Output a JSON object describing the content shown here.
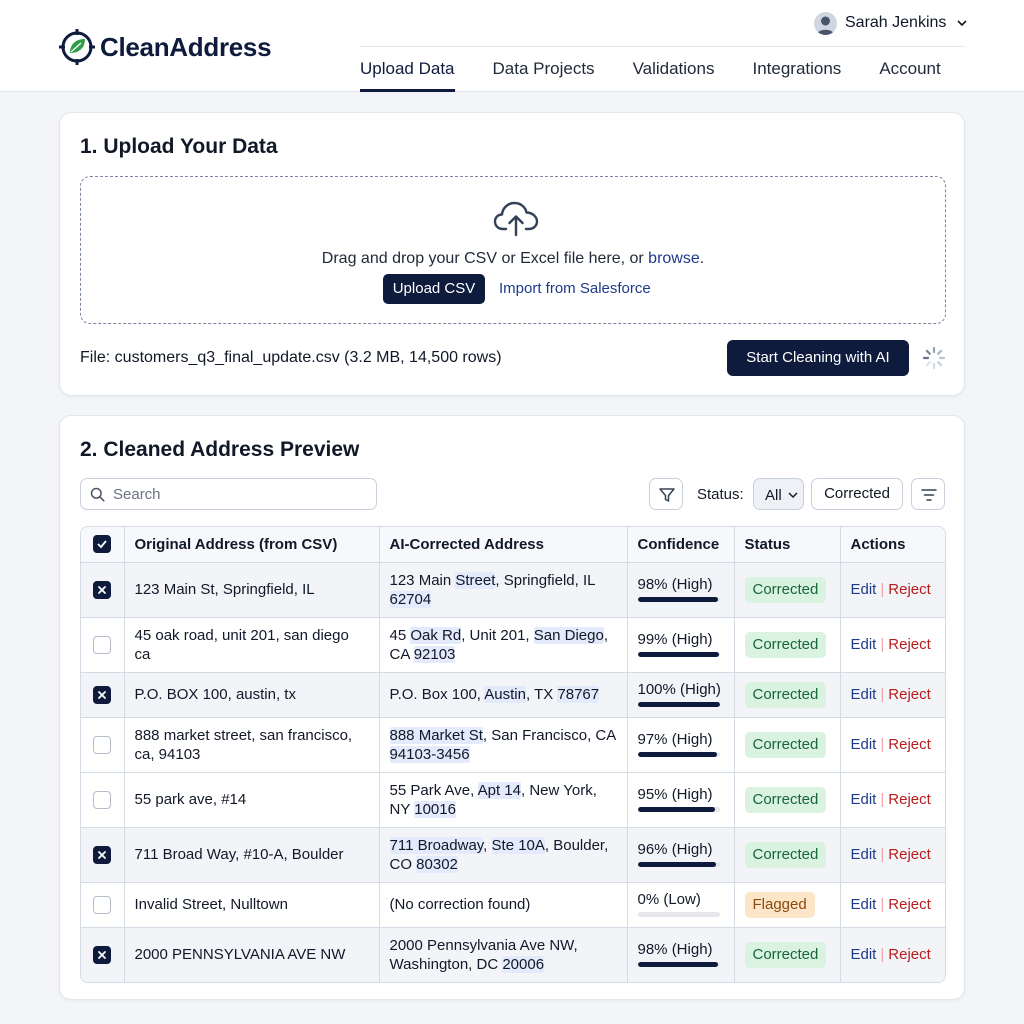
{
  "app": {
    "name": "CleanAddress"
  },
  "user": {
    "name": "Sarah Jenkins"
  },
  "nav": {
    "items": [
      {
        "label": "Upload Data",
        "active": true
      },
      {
        "label": "Data Projects"
      },
      {
        "label": "Validations"
      },
      {
        "label": "Integrations"
      },
      {
        "label": "Account"
      }
    ]
  },
  "upload": {
    "title": "1. Upload Your Data",
    "drop_text": "Drag and drop your CSV or Excel file here, or ",
    "browse_label": "browse",
    "drop_text_end": ".",
    "upload_button": "Upload CSV",
    "salesforce_link": "Import from Salesforce",
    "file_label": "File: customers_q3_final_update.csv (3.2 MB, 14,500 rows)",
    "start_button": "Start Cleaning with AI"
  },
  "preview": {
    "title": "2. Cleaned Address Preview",
    "search_placeholder": "Search",
    "status_label": "Status:",
    "status_value": "All",
    "corrected_chip": "Corrected",
    "columns": [
      "Original Address (from CSV)",
      "AI-Corrected Address",
      "Confidence",
      "Status",
      "Actions"
    ],
    "actions": {
      "edit": "Edit",
      "separator": "|",
      "reject": "Reject"
    },
    "rows": [
      {
        "checked": true,
        "original": "123 Main St, Springfield, IL",
        "corrected": [
          [
            "123 Main ",
            false
          ],
          [
            "Street",
            true
          ],
          [
            ", Springfield, IL ",
            false
          ],
          [
            "62704",
            true
          ]
        ],
        "confidence": "98% (High)",
        "level": 0.98,
        "status": "Corrected",
        "tone": "ok"
      },
      {
        "checked": false,
        "original": "45 oak road, unit 201, san diego ca",
        "corrected": [
          [
            "45 ",
            false
          ],
          [
            "Oak Rd",
            true
          ],
          [
            ", Unit 201, ",
            false
          ],
          [
            "San Diego",
            true
          ],
          [
            ", CA ",
            false
          ],
          [
            "92103",
            true
          ]
        ],
        "confidence": "99% (High)",
        "level": 0.99,
        "status": "Corrected",
        "tone": "ok"
      },
      {
        "checked": true,
        "original": "P.O. BOX 100, austin, tx",
        "corrected": [
          [
            "P.O. Box 100, ",
            false
          ],
          [
            "Austin",
            true
          ],
          [
            ", TX ",
            false
          ],
          [
            "78767",
            true
          ]
        ],
        "confidence": "100% (High)",
        "level": 1.0,
        "status": "Corrected",
        "tone": "ok"
      },
      {
        "checked": false,
        "original": "888 market street, san francisco, ca, 94103",
        "corrected": [
          [
            "888 Market St",
            true
          ],
          [
            ", San Francisco, CA ",
            false
          ],
          [
            "94103-3456",
            true
          ]
        ],
        "confidence": "97% (High)",
        "level": 0.97,
        "status": "Corrected",
        "tone": "ok"
      },
      {
        "checked": false,
        "original": "55 park ave, #14",
        "corrected": [
          [
            "55 Park Ave, ",
            false
          ],
          [
            "Apt 14",
            true
          ],
          [
            ", New York, NY ",
            false
          ],
          [
            "10016",
            true
          ]
        ],
        "confidence": "95% (High)",
        "level": 0.95,
        "status": "Corrected",
        "tone": "ok"
      },
      {
        "checked": true,
        "original": "711 Broad Way, #10-A, Boulder",
        "corrected": [
          [
            "711 Broadway",
            true
          ],
          [
            ", ",
            false
          ],
          [
            "Ste 10A",
            true
          ],
          [
            ", Boulder, CO ",
            false
          ],
          [
            "80302",
            true
          ]
        ],
        "confidence": "96% (High)",
        "level": 0.96,
        "status": "Corrected",
        "tone": "ok"
      },
      {
        "checked": false,
        "original": "Invalid Street, Nulltown",
        "corrected": [
          [
            "(No correction found)",
            false
          ]
        ],
        "confidence": "0% (Low)",
        "level": 0.0,
        "status": "Flagged",
        "tone": "flag"
      },
      {
        "checked": true,
        "original": "2000 PENNSYLVANIA AVE NW",
        "corrected": [
          [
            "2000 Pennsylvania Ave NW, Washington, DC ",
            false
          ],
          [
            "20006",
            true
          ]
        ],
        "confidence": "98% (High)",
        "level": 0.98,
        "status": "Corrected",
        "tone": "ok"
      }
    ]
  },
  "colors": {
    "brand": "#0f1b3d",
    "accent_green": "#2f9e44",
    "reject": "#b91c1c"
  }
}
